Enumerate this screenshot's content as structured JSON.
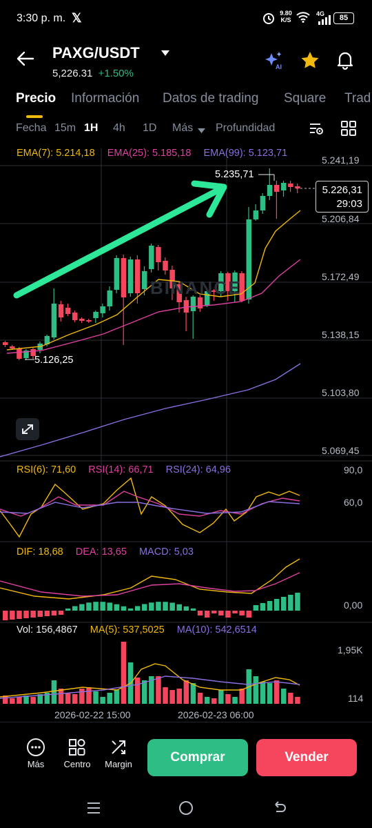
{
  "status": {
    "time": "3:30 p. m.",
    "speed_top": "9.80",
    "speed_unit": "K/S",
    "network": "4G",
    "battery": "85"
  },
  "header": {
    "pair": "PAXG/USDT",
    "price": "5,226.31",
    "change": "+1.50%"
  },
  "tabs": [
    {
      "label": "Precio"
    },
    {
      "label": "Información"
    },
    {
      "label": "Datos de trading"
    },
    {
      "label": "Square"
    },
    {
      "label": "Trad"
    }
  ],
  "intervals": {
    "fecha": "Fecha",
    "m15": "15m",
    "h1": "1H",
    "h4": "4h",
    "d1": "1D",
    "mas": "Más",
    "profundidad": "Profundidad"
  },
  "ema": {
    "ema7": "EMA(7): 5.214,18",
    "ema25": "EMA(25): 5.185,18",
    "ema99": "EMA(99): 5.123,71"
  },
  "price_axis": [
    "5.241,19",
    "5.206,84",
    "5.172,49",
    "5.138,15",
    "5.103,80",
    "5.069,45"
  ],
  "current_price_tag": {
    "price": "5.226,31",
    "countdown": "29:03"
  },
  "annotations": {
    "high": "5.235,71",
    "low": "5.126,25",
    "watermark": "BINANCE"
  },
  "rsi": {
    "rsi6": "RSI(6): 71,60",
    "rsi14": "RSI(14): 66,71",
    "rsi24": "RSI(24): 64,96",
    "axis_top": "90,0",
    "axis_mid": "60,0"
  },
  "macd": {
    "dif": "DIF: 18,68",
    "dea": "DEA: 13,65",
    "macd": "MACD: 5,03",
    "axis_zero": "0,00"
  },
  "volume": {
    "vol": "Vol: 156,4867",
    "ma5": "MA(5): 537,5025",
    "ma10": "MA(10): 542,6514",
    "axis_top": "1,95K",
    "axis_low": "114"
  },
  "time_axis": [
    "2026-02-22 15:00",
    "2026-02-23 06:00"
  ],
  "bottom": {
    "mas": "Más",
    "centro": "Centro",
    "margin": "Margin",
    "buy": "Comprar",
    "sell": "Vender"
  },
  "colors": {
    "up": "#2ebd85",
    "down": "#f6465d",
    "ema7": "#f0b90b",
    "ema25": "#e040a0",
    "ema99": "#8b6fe0",
    "accent": "#f0b90b"
  }
}
